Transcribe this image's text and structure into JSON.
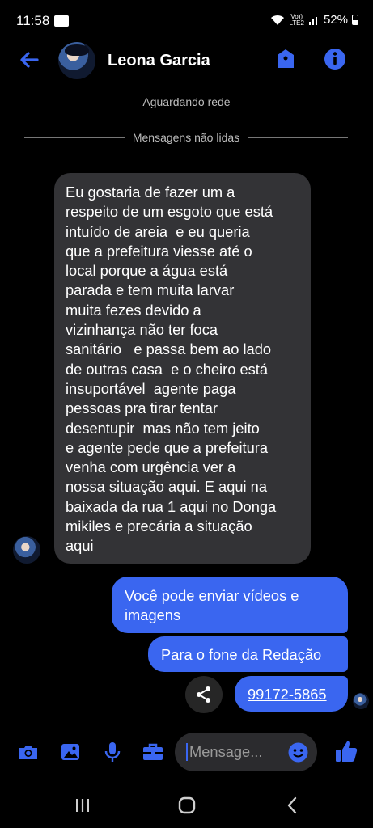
{
  "status_bar": {
    "time": "11:58",
    "network_top": "Vo))",
    "network_bottom": "LTE2",
    "battery": "52%"
  },
  "header": {
    "contact_name": "Leona Garcia"
  },
  "system": {
    "waiting": "Aguardando rede",
    "unread_divider": "Mensagens não lidas"
  },
  "messages": {
    "incoming_1": "Eu gostaria de fazer um a\nrespeito de um esgoto que está\nintuído de areia  e eu queria\nque a prefeitura viesse até o\nlocal porque a água está\nparada e tem muita larvar\nmuita fezes devido a\nvizinhança não ter foca\nsanitário   e passa bem ao lado\nde outras casa  e o cheiro está\ninsuportável  agente paga\npessoas pra tirar tentar\ndesentupir  mas não tem jeito\ne agente pede que a prefeitura\nvenha com urgência ver a\nnossa situação aqui. E aqui na\nbaixada da rua 1 aqui no Donga\nmikiles e precária a situação\naqui",
    "outgoing_1": "Você pode enviar vídeos e\nimagens",
    "outgoing_2": "Para o fone da Redação",
    "outgoing_3": "99172-5865"
  },
  "composer": {
    "placeholder": "Mensage..."
  },
  "colors": {
    "accent": "#3a66f0",
    "incoming_bubble": "#333336",
    "background": "#000000"
  },
  "icons": [
    "back-arrow-icon",
    "lock-icon",
    "info-icon",
    "share-icon",
    "camera-icon",
    "gallery-icon",
    "microphone-icon",
    "briefcase-icon",
    "emoji-icon",
    "thumbs-up-icon",
    "recents-icon",
    "home-icon",
    "back-icon"
  ]
}
